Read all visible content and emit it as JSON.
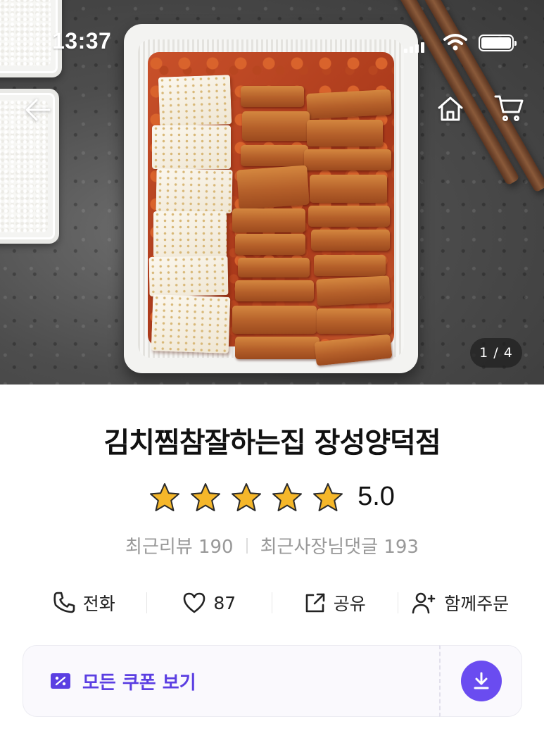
{
  "status_bar": {
    "time": "13:37",
    "signal_icon": "cellular-signal-icon",
    "wifi_icon": "wifi-icon",
    "battery_icon": "battery-icon"
  },
  "header": {
    "back_icon": "arrow-left-icon",
    "home_icon": "home-icon",
    "cart_icon": "cart-icon"
  },
  "gallery": {
    "counter": "1 / 4",
    "current": 1,
    "total": 4
  },
  "store": {
    "name": "김치찜참잘하는집 장성양덕점",
    "rating": 5.0,
    "rating_text": "5.0",
    "star_count": 5,
    "star_color": "#F5B72A",
    "recent_reviews_label": "최근리뷰 190",
    "owner_replies_label": "최근사장님댓글 193"
  },
  "actions": [
    {
      "id": "call",
      "label": "전화",
      "icon": "phone-icon"
    },
    {
      "id": "like",
      "label": "87",
      "icon": "heart-icon"
    },
    {
      "id": "share",
      "label": "공유",
      "icon": "share-icon"
    },
    {
      "id": "group",
      "label": "함께주문",
      "icon": "user-plus-icon"
    }
  ],
  "coupon": {
    "label": "모든 쿠폰 보기",
    "icon": "coupon-icon",
    "download_icon": "download-icon",
    "accent_color": "#5B3FE2"
  }
}
